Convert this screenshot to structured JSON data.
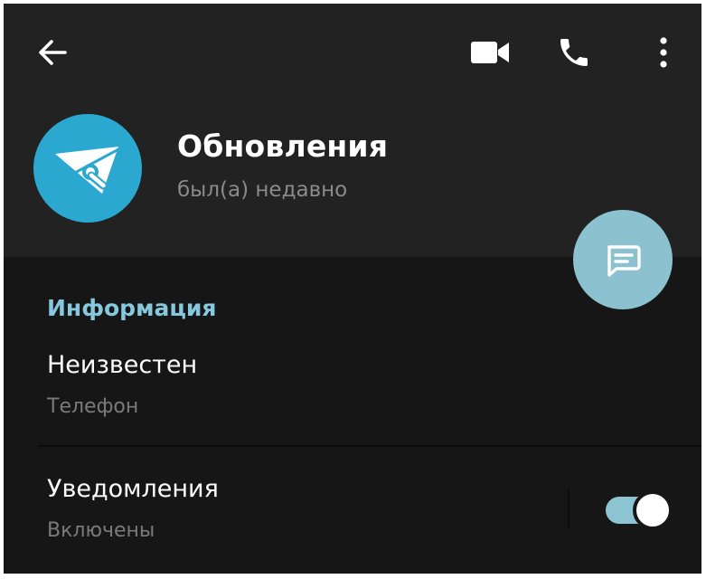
{
  "toolbar": {
    "back_icon": "arrow-left-icon",
    "video_icon": "video-camera-icon",
    "call_icon": "phone-icon",
    "menu_icon": "more-vertical-icon"
  },
  "profile": {
    "title": "Обновления",
    "status": "был(а) недавно",
    "avatar_icon": "telegram-wrench-icon",
    "avatar_color": "#2aa8d0"
  },
  "fab": {
    "icon": "message-icon",
    "color": "#8cc2cf"
  },
  "info": {
    "section_title": "Информация",
    "phone_value": "Неизвестен",
    "phone_label": "Телефон",
    "notifications_label": "Уведомления",
    "notifications_status": "Включены",
    "notifications_enabled": true
  },
  "colors": {
    "accent": "#86c8de",
    "background": "#161616",
    "header": "#222222"
  }
}
